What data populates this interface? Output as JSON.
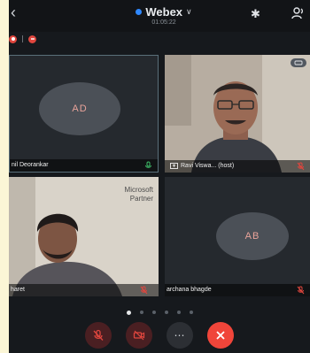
{
  "header": {
    "title": "Webex",
    "timer": "01:05:22"
  },
  "tiles": [
    {
      "initials": "AD",
      "name": "nil Deorankar"
    },
    {
      "name": "Ravi Viswa... (host)"
    },
    {
      "name": "haret",
      "overlay_lines": [
        "Microsoft",
        "Partner"
      ]
    },
    {
      "initials": "AB",
      "name": "archana bhagde"
    }
  ],
  "page_dots": {
    "count": 6,
    "active": 0
  },
  "colors": {
    "end_call": "#f0453a",
    "mute": "#e0463e",
    "accent": "#2f88ff",
    "avatar": "#4b5057"
  },
  "icons": [
    "back-icon",
    "chevron-down-icon",
    "bluetooth-icon",
    "participants-icon",
    "mic-muted-icon",
    "video-off-icon",
    "more-icon",
    "end-call-icon"
  ]
}
